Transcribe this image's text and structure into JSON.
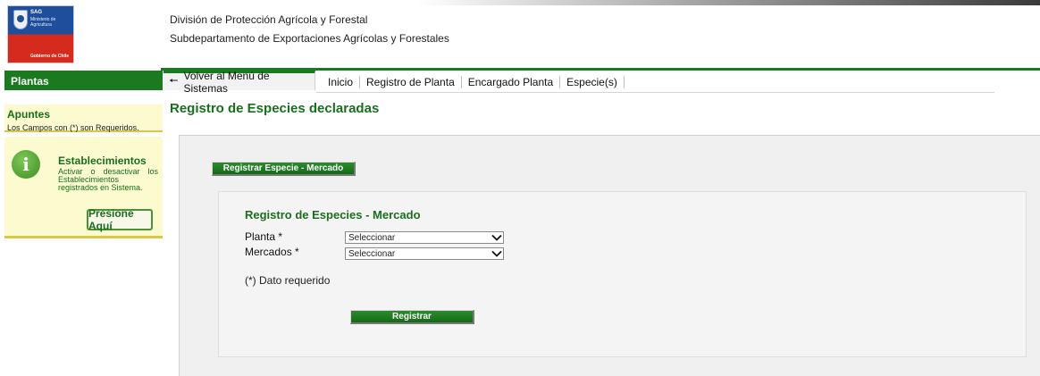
{
  "logo": {
    "brand": "SAG",
    "brand_sub": "Ministerio de Agricultura",
    "footer": "Gobierno de Chile"
  },
  "header": {
    "line1": "División de Protección Agrícola y Forestal",
    "line2": "Subdepartamento de Exportaciones Agrícolas y Forestales"
  },
  "sidebar": {
    "title": "Plantas",
    "apuntes_title": "Apuntes",
    "apuntes_text": "Los Campos con (*) son Requeridos.",
    "establecimientos": {
      "title": "Establecimientos",
      "description": "Activar o desactivar los Establecimientos registrados en Sistema.",
      "button": "Presione Aquí"
    }
  },
  "nav": {
    "back_label": "Volver al Menú de Sistemas",
    "items": [
      "Inicio",
      "Registro de Planta",
      "Encargado Planta",
      "Especie(s)"
    ]
  },
  "main": {
    "page_title": "Registro de Especies declaradas",
    "tab_button": "Registrar Especie - Mercado",
    "form": {
      "title": "Registro de Especies - Mercado",
      "planta_label": "Planta *",
      "planta_value": "Seleccionar",
      "mercados_label": "Mercados *",
      "mercados_value": "Seleccionar",
      "note": "(*) Dato requerido",
      "submit": "Registrar"
    }
  },
  "colors": {
    "accent_green": "#1b7a1f",
    "note_yellow": "#fbfbcf"
  },
  "icons": [
    "info-icon",
    "back-arrow-icon",
    "chevron-down-icon"
  ]
}
